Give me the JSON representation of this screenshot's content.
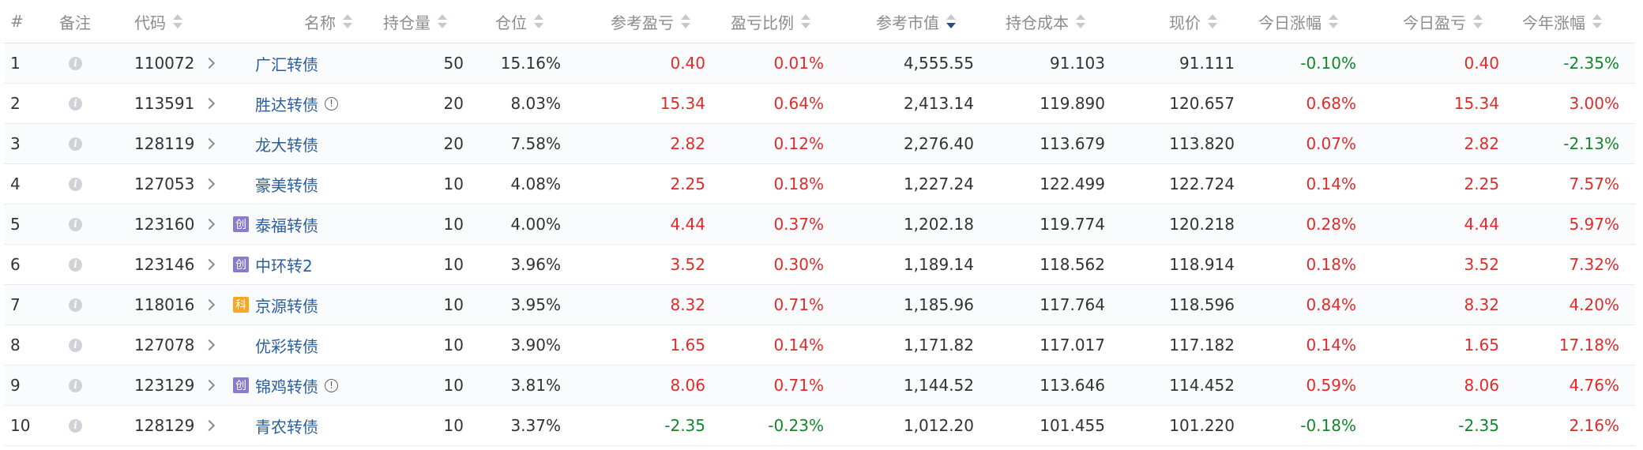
{
  "colors": {
    "up": "#e12b2b",
    "down": "#13862c",
    "name_link": "#2a5e9c",
    "header_text": "#8c8c8c",
    "sort_active": "#2a4f7f"
  },
  "headers": {
    "idx": "#",
    "note": "备注",
    "code": "代码",
    "name": "名称",
    "qty": "持仓量",
    "weight": "仓位",
    "pnl": "参考盈亏",
    "pnl_ratio": "盈亏比例",
    "mkt_value": "参考市值",
    "cost": "持仓成本",
    "price": "现价",
    "today_chg": "今日涨幅",
    "today_pnl": "今日盈亏",
    "ytd_chg": "今年涨幅"
  },
  "sorted_column": "mkt_value",
  "sort_order": "descending",
  "rows": [
    {
      "idx": "1",
      "code": "110072",
      "name": "广汇转债",
      "tag": "",
      "tag_label": "",
      "warn": false,
      "qty": "50",
      "weight": "15.16%",
      "pnl": "0.40",
      "pnl_ratio": "0.01%",
      "mkt_value": "4,555.55",
      "cost": "91.103",
      "price": "91.111",
      "today_chg": "-0.10%",
      "today_pnl": "0.40",
      "ytd_chg": "-2.35%"
    },
    {
      "idx": "2",
      "code": "113591",
      "name": "胜达转债",
      "tag": "",
      "tag_label": "",
      "warn": true,
      "qty": "20",
      "weight": "8.03%",
      "pnl": "15.34",
      "pnl_ratio": "0.64%",
      "mkt_value": "2,413.14",
      "cost": "119.890",
      "price": "120.657",
      "today_chg": "0.68%",
      "today_pnl": "15.34",
      "ytd_chg": "3.00%"
    },
    {
      "idx": "3",
      "code": "128119",
      "name": "龙大转债",
      "tag": "",
      "tag_label": "",
      "warn": false,
      "qty": "20",
      "weight": "7.58%",
      "pnl": "2.82",
      "pnl_ratio": "0.12%",
      "mkt_value": "2,276.40",
      "cost": "113.679",
      "price": "113.820",
      "today_chg": "0.07%",
      "today_pnl": "2.82",
      "ytd_chg": "-2.13%"
    },
    {
      "idx": "4",
      "code": "127053",
      "name": "豪美转债",
      "tag": "",
      "tag_label": "",
      "warn": false,
      "qty": "10",
      "weight": "4.08%",
      "pnl": "2.25",
      "pnl_ratio": "0.18%",
      "mkt_value": "1,227.24",
      "cost": "122.499",
      "price": "122.724",
      "today_chg": "0.14%",
      "today_pnl": "2.25",
      "ytd_chg": "7.57%"
    },
    {
      "idx": "5",
      "code": "123160",
      "name": "泰福转债",
      "tag": "chuang",
      "tag_label": "创",
      "warn": false,
      "qty": "10",
      "weight": "4.00%",
      "pnl": "4.44",
      "pnl_ratio": "0.37%",
      "mkt_value": "1,202.18",
      "cost": "119.774",
      "price": "120.218",
      "today_chg": "0.28%",
      "today_pnl": "4.44",
      "ytd_chg": "5.97%"
    },
    {
      "idx": "6",
      "code": "123146",
      "name": "中环转2",
      "tag": "chuang",
      "tag_label": "创",
      "warn": false,
      "qty": "10",
      "weight": "3.96%",
      "pnl": "3.52",
      "pnl_ratio": "0.30%",
      "mkt_value": "1,189.14",
      "cost": "118.562",
      "price": "118.914",
      "today_chg": "0.18%",
      "today_pnl": "3.52",
      "ytd_chg": "7.32%"
    },
    {
      "idx": "7",
      "code": "118016",
      "name": "京源转债",
      "tag": "ke",
      "tag_label": "科",
      "warn": false,
      "qty": "10",
      "weight": "3.95%",
      "pnl": "8.32",
      "pnl_ratio": "0.71%",
      "mkt_value": "1,185.96",
      "cost": "117.764",
      "price": "118.596",
      "today_chg": "0.84%",
      "today_pnl": "8.32",
      "ytd_chg": "4.20%"
    },
    {
      "idx": "8",
      "code": "127078",
      "name": "优彩转债",
      "tag": "",
      "tag_label": "",
      "warn": false,
      "qty": "10",
      "weight": "3.90%",
      "pnl": "1.65",
      "pnl_ratio": "0.14%",
      "mkt_value": "1,171.82",
      "cost": "117.017",
      "price": "117.182",
      "today_chg": "0.14%",
      "today_pnl": "1.65",
      "ytd_chg": "17.18%"
    },
    {
      "idx": "9",
      "code": "123129",
      "name": "锦鸡转债",
      "tag": "chuang",
      "tag_label": "创",
      "warn": true,
      "qty": "10",
      "weight": "3.81%",
      "pnl": "8.06",
      "pnl_ratio": "0.71%",
      "mkt_value": "1,144.52",
      "cost": "113.646",
      "price": "114.452",
      "today_chg": "0.59%",
      "today_pnl": "8.06",
      "ytd_chg": "4.76%"
    },
    {
      "idx": "10",
      "code": "128129",
      "name": "青农转债",
      "tag": "",
      "tag_label": "",
      "warn": false,
      "qty": "10",
      "weight": "3.37%",
      "pnl": "-2.35",
      "pnl_ratio": "-0.23%",
      "mkt_value": "1,012.20",
      "cost": "101.455",
      "price": "101.220",
      "today_chg": "-0.18%",
      "today_pnl": "-2.35",
      "ytd_chg": "2.16%"
    }
  ]
}
